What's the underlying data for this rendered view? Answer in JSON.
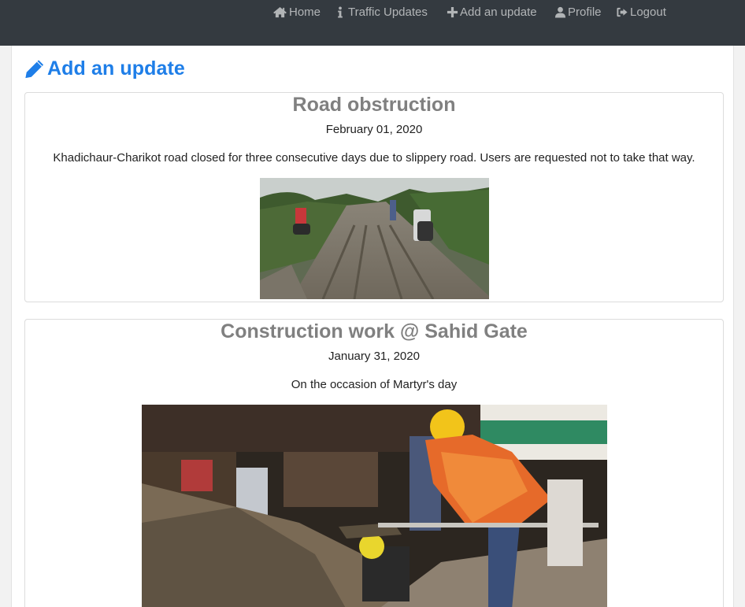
{
  "nav": {
    "home": "Home",
    "traffic_updates": "Traffic Updates",
    "add_update": "Add an update",
    "profile": "Profile",
    "logout": "Logout"
  },
  "page": {
    "title": "Add an update"
  },
  "posts": [
    {
      "title": "Road obstruction",
      "date": "February 01, 2020",
      "description": "Khadichaur-Charikot road closed for three consecutive days due to slippery road. Users are requested not to take that way."
    },
    {
      "title": "Construction work @ Sahid Gate",
      "date": "January 31, 2020",
      "description": "On the occasion of Martyr's day"
    }
  ],
  "colors": {
    "navbar": "#343a40",
    "accent": "#1e7ee8",
    "post_title": "#808080"
  },
  "icons": {
    "home": "home-icon",
    "traffic_updates": "info-icon",
    "add_update": "plus-icon",
    "profile": "user-icon",
    "logout": "sign-out-icon",
    "title": "pencil-icon"
  }
}
